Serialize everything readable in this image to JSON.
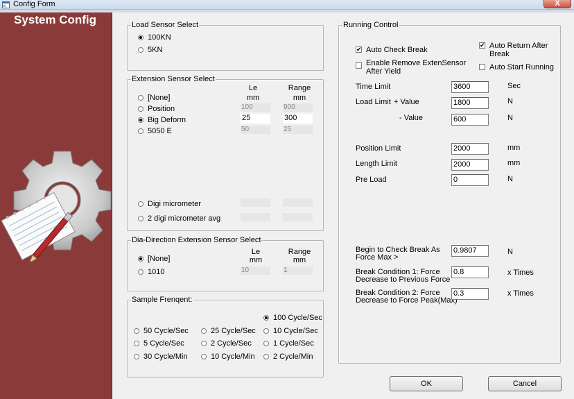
{
  "window": {
    "title": "Config Form",
    "close_label": "X"
  },
  "sidebar": {
    "heading": "System Config"
  },
  "load_sensor": {
    "title": "Load Sensor Select",
    "options": [
      {
        "label": "100KN",
        "checked": true
      },
      {
        "label": "5KN",
        "checked": false
      }
    ]
  },
  "extension_sensor": {
    "title": "Extension Sensor Select",
    "col_le": "Le",
    "col_le_unit": "mm",
    "col_range": "Range",
    "col_range_unit": "mm",
    "rows": [
      {
        "label": "[None]",
        "checked": false,
        "le": "",
        "range": ""
      },
      {
        "label": "Position",
        "checked": false,
        "le": "100",
        "range": "900"
      },
      {
        "label": "Big Deform",
        "checked": true,
        "le": "25",
        "range": "300"
      },
      {
        "label": "5050 E",
        "checked": false,
        "le": "50",
        "range": "25"
      }
    ],
    "digi_micrometer": "Digi micrometer",
    "digi_micrometer_avg": "2 digi micrometer avg"
  },
  "dia_sensor": {
    "title": "Dia-Direction Extension Sensor Select",
    "col_le": "Le",
    "col_le_unit": "mm",
    "col_range": "Range",
    "col_range_unit": "mm",
    "rows": [
      {
        "label": "[None]",
        "checked": true,
        "le": "",
        "range": ""
      },
      {
        "label": "1010",
        "checked": false,
        "le": "10",
        "range": "1"
      }
    ]
  },
  "sample_freq": {
    "title": "Sample Frenqent:",
    "options": {
      "c100": "100 Cycle/Sec",
      "c50": "50 Cycle/Sec",
      "c25": "25 Cycle/Sec",
      "c10": "10 Cycle/Sec",
      "c5": "5 Cycle/Sec",
      "c2": "2 Cycle/Sec",
      "c1": "1 Cycle/Sec",
      "m30": "30 Cycle/Min",
      "m10": "10 Cycle/Min",
      "m2": "2 Cycle/Min"
    },
    "selected": "100 Cycle/Sec"
  },
  "running": {
    "title": "Running Control",
    "auto_check_break": {
      "label": "Auto Check Break",
      "checked": true
    },
    "auto_return_after_break": {
      "label_line1": "Auto Return After",
      "label_line2": "Break",
      "checked": true
    },
    "enable_remove": {
      "label_line1": "Enable Remove ExtenSensor",
      "label_line2": "After Yield",
      "checked": false
    },
    "auto_start_running": {
      "label": "Auto Start Running",
      "checked": false
    },
    "time_limit": {
      "label": "Time Limit",
      "value": "3600",
      "unit": "Sec"
    },
    "load_limit_plus": {
      "label": "Load Limit",
      "sub": "+ Value",
      "value": "1800",
      "unit": "N"
    },
    "load_limit_minus": {
      "sub": "- Value",
      "value": "600",
      "unit": "N"
    },
    "position_limit": {
      "label": "Position Limit",
      "value": "2000",
      "unit": "mm"
    },
    "length_limit": {
      "label": "Length Limit",
      "value": "2000",
      "unit": "mm"
    },
    "pre_load": {
      "label": "Pre Load",
      "value": "0",
      "unit": "N"
    },
    "begin_check": {
      "label_line1": "Begin to Check Break As",
      "label_line2": "Force Max >",
      "value": "0.9807",
      "unit": "N"
    },
    "break_cond_1": {
      "label_line1": "Break Condition 1: Force",
      "label_line2": "Decrease to Previous Force",
      "value": "0.8",
      "unit": "x Times"
    },
    "break_cond_2": {
      "label_line1": "Break Condition 2: Force",
      "label_line2": "Decrease to Force Peak(Max)",
      "value": "0.3",
      "unit": "x Times"
    }
  },
  "buttons": {
    "ok": "OK",
    "cancel": "Cancel"
  }
}
